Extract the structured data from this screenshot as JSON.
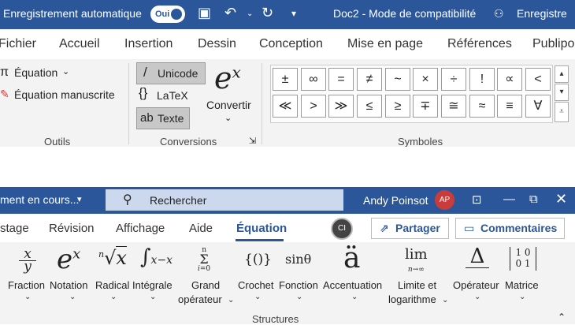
{
  "top": {
    "autosave_label": "Enregistrement automatique",
    "toggle_state": "Oui",
    "doc_title": "Doc2  -  Mode de compatibilité",
    "title_right": "Enregistre",
    "tabs": [
      "Fichier",
      "Accueil",
      "Insertion",
      "Dessin",
      "Conception",
      "Mise en page",
      "Références",
      "Publipo"
    ],
    "tools": {
      "equation_label": "Équation",
      "ink_label": "Équation manuscrite",
      "group_label": "Outils"
    },
    "conversions": {
      "unicode": "Unicode",
      "latex": "LaTeX",
      "text": "Texte",
      "convert": "Convertir",
      "group_label": "Conversions"
    },
    "symbols": {
      "row1": [
        "±",
        "∞",
        "=",
        "≠",
        "~",
        "×",
        "÷",
        "!",
        "∝",
        "<"
      ],
      "row2": [
        "≪",
        ">",
        "≫",
        "≤",
        "≥",
        "∓",
        "≅",
        "≈",
        "≡",
        "∀"
      ],
      "group_label": "Symboles"
    }
  },
  "bottom": {
    "status_text": "ment en cours...",
    "search_placeholder": "Rechercher",
    "user_name": "Andy Poinsot",
    "avatar_initials": "AP",
    "tabs": [
      "stage",
      "Révision",
      "Affichage",
      "Aide",
      "Équation"
    ],
    "coauthor_initials": "CI",
    "share_label": "Partager",
    "comments_label": "Commentaires",
    "structures": [
      {
        "label1": "Fraction",
        "label2": ""
      },
      {
        "label1": "Notation",
        "label2": ""
      },
      {
        "label1": "Radical",
        "label2": ""
      },
      {
        "label1": "Intégrale",
        "label2": ""
      },
      {
        "label1": "Grand",
        "label2": "opérateur"
      },
      {
        "label1": "Crochet",
        "label2": ""
      },
      {
        "label1": "Fonction",
        "label2": ""
      },
      {
        "label1": "Accentuation",
        "label2": ""
      },
      {
        "label1": "Limite et",
        "label2": "logarithme"
      },
      {
        "label1": "Opérateur",
        "label2": ""
      },
      {
        "label1": "Matrice",
        "label2": ""
      }
    ],
    "group_label": "Structures"
  }
}
